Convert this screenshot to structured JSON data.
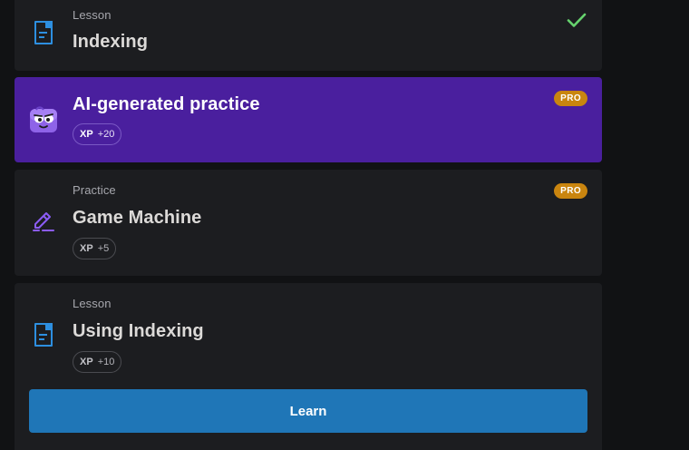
{
  "items": [
    {
      "kicker": "Lesson",
      "title": "Indexing",
      "status_icon": "check-icon",
      "item_icon": "document-icon"
    },
    {
      "title": "AI-generated practice",
      "xp_label": "XP",
      "xp_value": "+20",
      "badge": "PRO",
      "item_icon": "robot-mascot-icon"
    },
    {
      "kicker": "Practice",
      "title": "Game Machine",
      "xp_label": "XP",
      "xp_value": "+5",
      "badge": "PRO",
      "item_icon": "pencil-icon"
    },
    {
      "kicker": "Lesson",
      "title": "Using Indexing",
      "xp_label": "XP",
      "xp_value": "+10",
      "item_icon": "document-icon",
      "action_label": "Learn"
    }
  ],
  "colors": {
    "background": "#111214",
    "card": "#1c1d20",
    "ai_card": "#4a1f9e",
    "pro_badge": "#c9850f",
    "learn_button": "#1f76b7",
    "check": "#66d36e",
    "lesson_icon": "#2d8fe0",
    "practice_icon": "#8b5cf6"
  }
}
